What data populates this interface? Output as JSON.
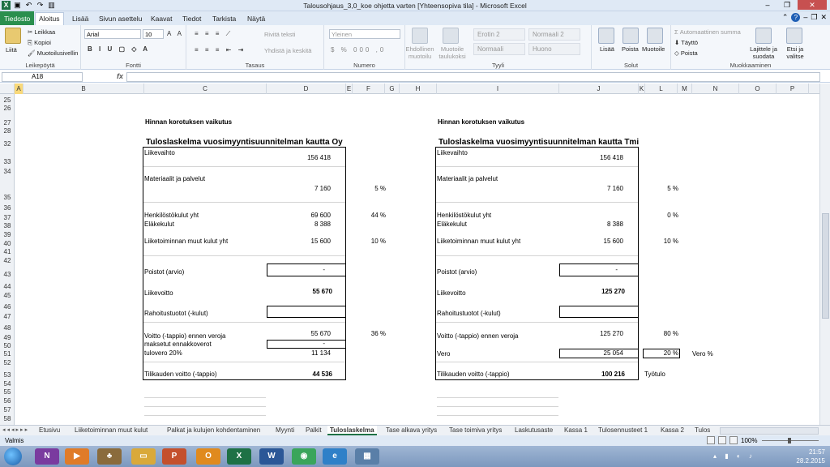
{
  "window": {
    "title": "Talousohjaus_3,0_koe ohjetta varten  [Yhteensopiva tila]  -  Microsoft Excel"
  },
  "ribbon_tabs": [
    "Tiedosto",
    "Aloitus",
    "Lisää",
    "Sivun asettelu",
    "Kaavat",
    "Tiedot",
    "Tarkista",
    "Näytä"
  ],
  "ribbon": {
    "clipboard": {
      "paste": "Liitä",
      "cut": "Leikkaa",
      "copy": "Kopioi",
      "format_painter": "Muotoilusivellin",
      "label": "Leikepöytä"
    },
    "font": {
      "name": "Arial",
      "size": "10",
      "label": "Fontti"
    },
    "alignment": {
      "wrap": "Rivitä teksti",
      "merge": "Yhdistä ja keskitä",
      "label": "Tasaus"
    },
    "number": {
      "format": "Yleinen",
      "label": "Numero"
    },
    "styles": {
      "conditional": "Ehdollinen muotoilu",
      "table": "Muotoile taulukoksi",
      "cells": [
        "Erotin 2",
        "Normaali 2",
        "Normaali",
        "Huono"
      ],
      "label": "Tyyli"
    },
    "cells": {
      "insert": "Lisää",
      "delete": "Poista",
      "format": "Muotoile",
      "label": "Solut"
    },
    "editing": {
      "autosum": "Automaattinen summa",
      "fill": "Täyttö",
      "clear": "Poista",
      "sort": "Lajittele ja suodata",
      "find": "Etsi ja valitse",
      "label": "Muokkaaminen"
    }
  },
  "formula_bar": {
    "name_box": "A18",
    "fx": "fx",
    "formula": ""
  },
  "columns": [
    "A",
    "B",
    "C",
    "D",
    "E",
    "F",
    "G",
    "H",
    "I",
    "J",
    "K",
    "L",
    "M",
    "N",
    "O",
    "P"
  ],
  "rows": [
    "25",
    "26",
    "27",
    "28",
    "32",
    "33",
    "34",
    "35",
    "36",
    "37",
    "38",
    "39",
    "40",
    "41",
    "42",
    "43",
    "44",
    "45",
    "46",
    "47",
    "48",
    "49",
    "50",
    "51",
    "52",
    "53",
    "54",
    "55",
    "56",
    "57",
    "58"
  ],
  "left": {
    "heading": "Hinnan korotuksen vaikutus",
    "title": "Tuloslaskelma vuosimyyntisuunnitelman kautta Oy",
    "liikevaihto": "Liikevaihto",
    "liikevaihto_val": "156 418",
    "materiaalit": "Materiaalit ja palvelut",
    "materiaalit_val": "7 160",
    "materiaalit_pct": "5 %",
    "henkilosto": "Henkilöstökulut yht",
    "henkilosto_val": "69 600",
    "henkilosto_pct": "44 %",
    "elake": "Eläkekulut",
    "elake_val": "8 388",
    "muut": "Liiketoiminnan muut kulut yht",
    "muut_val": "15 600",
    "muut_pct": "10 %",
    "poistot": "Poistot (arvio)",
    "poistot_val": "-",
    "liikevoitto": "Liikevoitto",
    "liikevoitto_val": "55 670",
    "rahoitus": "Rahoitustuotot (-kulut)",
    "voitto": "Voitto (-tappio) ennen veroja",
    "voitto_val": "55 670",
    "voitto_pct": "36 %",
    "ennakko": "maksetut ennakkoverot",
    "ennakko_val": "-",
    "tulovero": "tulovero 20%",
    "tulovero_val": "11 134",
    "tilikausi": "Tilikauden voitto (-tappio)",
    "tilikausi_val": "44 536"
  },
  "right": {
    "heading": "Hinnan korotuksen vaikutus",
    "title": "Tuloslaskelma vuosimyyntisuunnitelman kautta Tmi",
    "liikevaihto": "Liikevaihto",
    "liikevaihto_val": "156 418",
    "materiaalit": "Materiaalit ja palvelut",
    "materiaalit_val": "7 160",
    "materiaalit_pct": "5 %",
    "henkilosto": "Henkilöstökulut yht",
    "henkilosto_pct": "0 %",
    "elake": "Eläkekulut",
    "elake_val": "8 388",
    "muut": "Liiketoiminnan muut kulut yht",
    "muut_val": "15 600",
    "muut_pct": "10 %",
    "poistot": "Poistot (arvio)",
    "poistot_val": "-",
    "liikevoitto": "Liikevoitto",
    "liikevoitto_val": "125 270",
    "rahoitus": "Rahoitustuotot (-kulut)",
    "voitto": "Voitto (-tappio) ennen veroja",
    "voitto_val": "125 270",
    "voitto_pct": "80 %",
    "vero": "Vero",
    "vero_val": "25 054",
    "vero_pct": "20 %",
    "vero_label": "Vero %",
    "tilikausi": "Tilikauden voitto (-tappio)",
    "tilikausi_val": "100 216",
    "tyotulo": "Työtulo"
  },
  "sheet_tabs": [
    "Etusivu",
    "Liiketoiminnan muut kulut",
    "Palkat ja kulujen kohdentaminen",
    "Myynti",
    "Palkit",
    "Tuloslaskelma",
    "Tase alkava yritys",
    "Tase toimiva yritys",
    "Laskutusaste",
    "Kassa 1",
    "Tulosennusteet 1",
    "Kassa 2",
    "Tulos"
  ],
  "status": {
    "ready": "Valmis",
    "zoom": "100%"
  },
  "taskbar": {
    "time": "21:57",
    "date": "28.2.2015",
    "apps": [
      "N",
      "▶",
      "♣",
      "▭",
      "P",
      "O",
      "X",
      "W",
      "◉",
      "e",
      "▦"
    ]
  }
}
